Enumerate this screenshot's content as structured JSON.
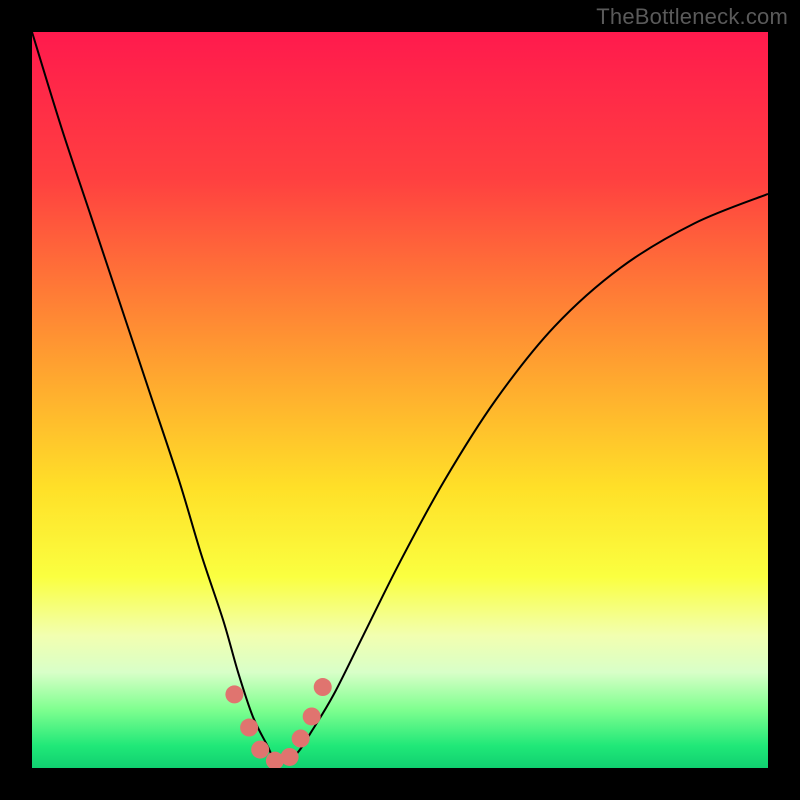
{
  "watermark": "TheBottleneck.com",
  "chart_data": {
    "type": "line",
    "title": "",
    "xlabel": "",
    "ylabel": "",
    "xlim": [
      0,
      100
    ],
    "ylim": [
      0,
      100
    ],
    "gradient_stops": [
      {
        "offset": 0,
        "color": "#ff1a4d"
      },
      {
        "offset": 20,
        "color": "#ff4040"
      },
      {
        "offset": 45,
        "color": "#ffa030"
      },
      {
        "offset": 62,
        "color": "#ffe028"
      },
      {
        "offset": 74,
        "color": "#faff40"
      },
      {
        "offset": 82,
        "color": "#f2ffb0"
      },
      {
        "offset": 87,
        "color": "#d8ffc8"
      },
      {
        "offset": 92,
        "color": "#80ff90"
      },
      {
        "offset": 97,
        "color": "#20e878"
      },
      {
        "offset": 100,
        "color": "#10d070"
      }
    ],
    "series": [
      {
        "name": "curve",
        "type": "line",
        "x": [
          0,
          4,
          8,
          12,
          16,
          20,
          23,
          26,
          28,
          30,
          32,
          33,
          34,
          36,
          38,
          41,
          45,
          50,
          56,
          63,
          71,
          80,
          90,
          100
        ],
        "y": [
          100,
          87,
          75,
          63,
          51,
          39,
          29,
          20,
          13,
          7,
          3,
          1,
          1,
          2,
          5,
          10,
          18,
          28,
          39,
          50,
          60,
          68,
          74,
          78
        ]
      },
      {
        "name": "markers",
        "type": "scatter",
        "x": [
          27.5,
          29.5,
          31.0,
          33.0,
          35.0,
          36.5,
          38.0,
          39.5
        ],
        "y": [
          10.0,
          5.5,
          2.5,
          1.0,
          1.5,
          4.0,
          7.0,
          11.0
        ]
      }
    ],
    "marker_color": "#e0746f",
    "marker_radius": 9,
    "line_color": "#000000",
    "line_width": 2.0
  }
}
